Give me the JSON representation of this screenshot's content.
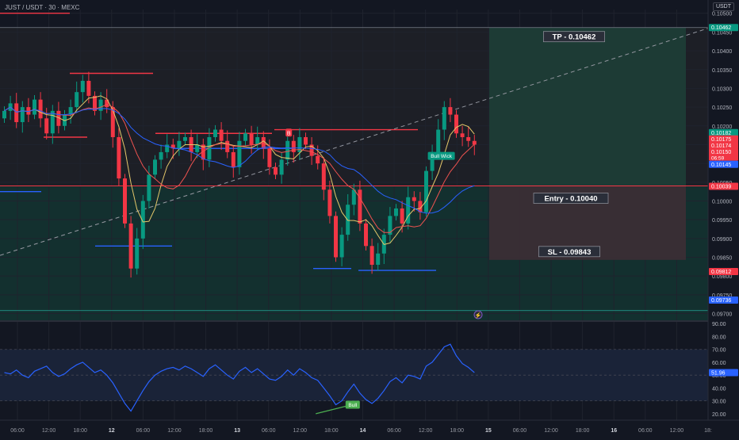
{
  "header": {
    "symbol_line": "JUST / USDT · 30 · MEXC",
    "currency": "USDT"
  },
  "colors": {
    "background": "#131722",
    "up": "#089981",
    "down": "#f23645",
    "grid": "#1f232e",
    "ma_blue": "#2962ff",
    "rsi_line": "#2962ff",
    "profit_zone": "#1e3d36",
    "loss_zone": "#3a2e35"
  },
  "chart_data": [
    {
      "type": "candlestick",
      "title": "JUST / USDT · 30 · MEXC",
      "y_axis_ticks": [
        "0.10500",
        "0.10450",
        "0.10400",
        "0.10350",
        "0.10300",
        "0.10250",
        "0.10200",
        "0.10150",
        "0.10100",
        "0.10050",
        "0.10000",
        "0.09950",
        "0.09900",
        "0.09850",
        "0.09800",
        "0.09750",
        "0.09700"
      ],
      "ylim": [
        0.0968,
        0.1051
      ],
      "x_axis_ticks": [
        "06:00",
        "12:00",
        "18:00",
        "12",
        "06:00",
        "12:00",
        "18:00",
        "13",
        "06:00",
        "12:00",
        "18:00",
        "14",
        "06:00",
        "12:00",
        "18:00",
        "15",
        "06:00",
        "12:00",
        "18:00",
        "16",
        "06:00",
        "12:00",
        "18:"
      ],
      "price_labels": [
        {
          "text": "0.10462",
          "value": 0.10462,
          "color": "#089981"
        },
        {
          "text": "0.10182",
          "value": 0.10182,
          "color": "#089981"
        },
        {
          "text": "0.10175",
          "value": 0.10175,
          "color": "#f23645"
        },
        {
          "text": "0.10174",
          "value": 0.10174,
          "color": "#f23645"
        },
        {
          "text": "0.10150",
          "sub": "06:59",
          "value": 0.1015,
          "color": "#f23645"
        },
        {
          "text": "0.10145",
          "value": 0.10145,
          "color": "#2962ff"
        },
        {
          "text": "0.10039",
          "value": 0.10039,
          "color": "#f23645"
        },
        {
          "text": "0.09812",
          "value": 0.09812,
          "color": "#f23645"
        },
        {
          "text": "0.09736",
          "value": 0.09736,
          "color": "#2962ff"
        }
      ],
      "trade_setup": {
        "tp_label": "TP - 0.10462",
        "tp": 0.10462,
        "entry_label": "Entry - 0.10040",
        "entry": 0.1004,
        "sl_label": "SL - 0.09843",
        "sl": 0.09843,
        "start_time": "15 00:00"
      },
      "annotations": [
        {
          "text": "Bull Wick",
          "color": "#089981"
        },
        {
          "text": "B",
          "color": "#f23645"
        }
      ],
      "horizontal_levels": [
        {
          "value": 0.105,
          "color": "#f23645"
        },
        {
          "value": 0.1034,
          "color": "#f23645"
        },
        {
          "value": 0.1018,
          "color": "#f23645"
        },
        {
          "value": 0.1019,
          "color": "#f23645"
        },
        {
          "value": 0.1017,
          "color": "#f23645"
        },
        {
          "value": 0.1014,
          "color": "#2962ff"
        },
        {
          "value": 0.10025,
          "color": "#2962ff"
        },
        {
          "value": 0.0988,
          "color": "#2962ff"
        },
        {
          "value": 0.0982,
          "color": "#2962ff"
        },
        {
          "value": 0.09815,
          "color": "#2962ff"
        },
        {
          "value": 0.0974,
          "color": "#2962ff"
        }
      ],
      "close_series": [
        0.1024,
        0.1026,
        0.1021,
        0.1025,
        0.1023,
        0.1027,
        0.1022,
        0.1018,
        0.1024,
        0.102,
        0.1023,
        0.1025,
        0.1029,
        0.1032,
        0.1028,
        0.1024,
        0.1027,
        0.1025,
        0.1017,
        0.1006,
        0.0994,
        0.0982,
        0.099,
        0.1,
        0.1007,
        0.1011,
        0.1013,
        0.1015,
        0.1014,
        0.1016,
        0.1017,
        0.1013,
        0.1015,
        0.1011,
        0.1017,
        0.1019,
        0.1016,
        0.1013,
        0.1009,
        0.1016,
        0.1018,
        0.1015,
        0.1017,
        0.1014,
        0.1009,
        0.1007,
        0.1011,
        0.1016,
        0.1013,
        0.1017,
        0.1015,
        0.1012,
        0.101,
        0.1003,
        0.0996,
        0.0985,
        0.0991,
        0.0999,
        0.1003,
        0.0994,
        0.0988,
        0.0983,
        0.0986,
        0.0991,
        0.0996,
        0.0998,
        0.0994,
        0.1001,
        0.1,
        0.0997,
        0.1008,
        0.1013,
        0.1019,
        0.1025,
        0.1023,
        0.1018,
        0.1017,
        0.1016,
        0.1015
      ]
    },
    {
      "type": "line",
      "title": "RSI",
      "y_axis_ticks": [
        "90.00",
        "80.00",
        "70.00",
        "60.00",
        "50.00",
        "40.00",
        "30.00",
        "20.00"
      ],
      "ylim": [
        15,
        92
      ],
      "bands": [
        70,
        50,
        30
      ],
      "current_label": "51.96",
      "current": 51.96,
      "annotation": "Bull",
      "values": [
        52,
        51,
        54,
        50,
        48,
        53,
        55,
        57,
        52,
        49,
        51,
        55,
        58,
        60,
        56,
        52,
        54,
        50,
        44,
        36,
        28,
        22,
        30,
        38,
        45,
        50,
        53,
        55,
        56,
        54,
        57,
        55,
        52,
        49,
        55,
        58,
        54,
        50,
        47,
        53,
        56,
        52,
        55,
        51,
        47,
        46,
        49,
        54,
        50,
        55,
        52,
        48,
        46,
        40,
        34,
        27,
        30,
        37,
        43,
        36,
        31,
        28,
        32,
        38,
        45,
        48,
        44,
        50,
        49,
        47,
        57,
        60,
        66,
        72,
        74,
        65,
        59,
        56,
        52
      ]
    }
  ]
}
